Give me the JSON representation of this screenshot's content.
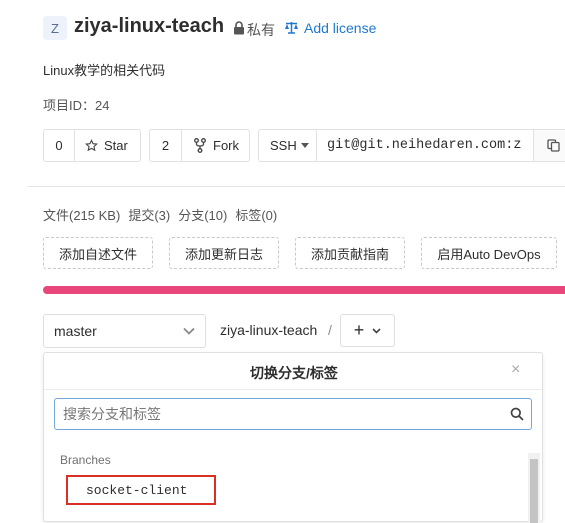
{
  "project": {
    "avatar_letter": "Z",
    "name": "ziya-linux-teach",
    "visibility": "私有",
    "license_link": "Add license",
    "description": "Linux教学的相关代码",
    "id_label": "项目ID：24"
  },
  "actions": {
    "star_count": "0",
    "star_label": "Star",
    "fork_count": "2",
    "fork_label": "Fork",
    "protocol": "SSH",
    "clone_url": "git@git.neihedaren.com:z"
  },
  "stats": {
    "files": "文件(215 KB)",
    "commits": "提交(3)",
    "branches": "分支(10)",
    "tags": "标签(0)"
  },
  "quick_actions": [
    "添加自述文件",
    "添加更新日志",
    "添加贡献指南",
    "启用Auto DevOps"
  ],
  "nav": {
    "branch_selected": "master",
    "breadcrumb": "ziya-linux-teach",
    "separator": "/",
    "add_symbol": "+"
  },
  "dropdown": {
    "title": "切换分支/标签",
    "close": "×",
    "search_placeholder": "搜索分支和标签",
    "section_branches": "Branches",
    "items": [
      "socket-client"
    ]
  },
  "colors": {
    "accent_link": "#1f78d1",
    "progress_bar": "#e9467c",
    "highlight_box": "#d93025"
  }
}
